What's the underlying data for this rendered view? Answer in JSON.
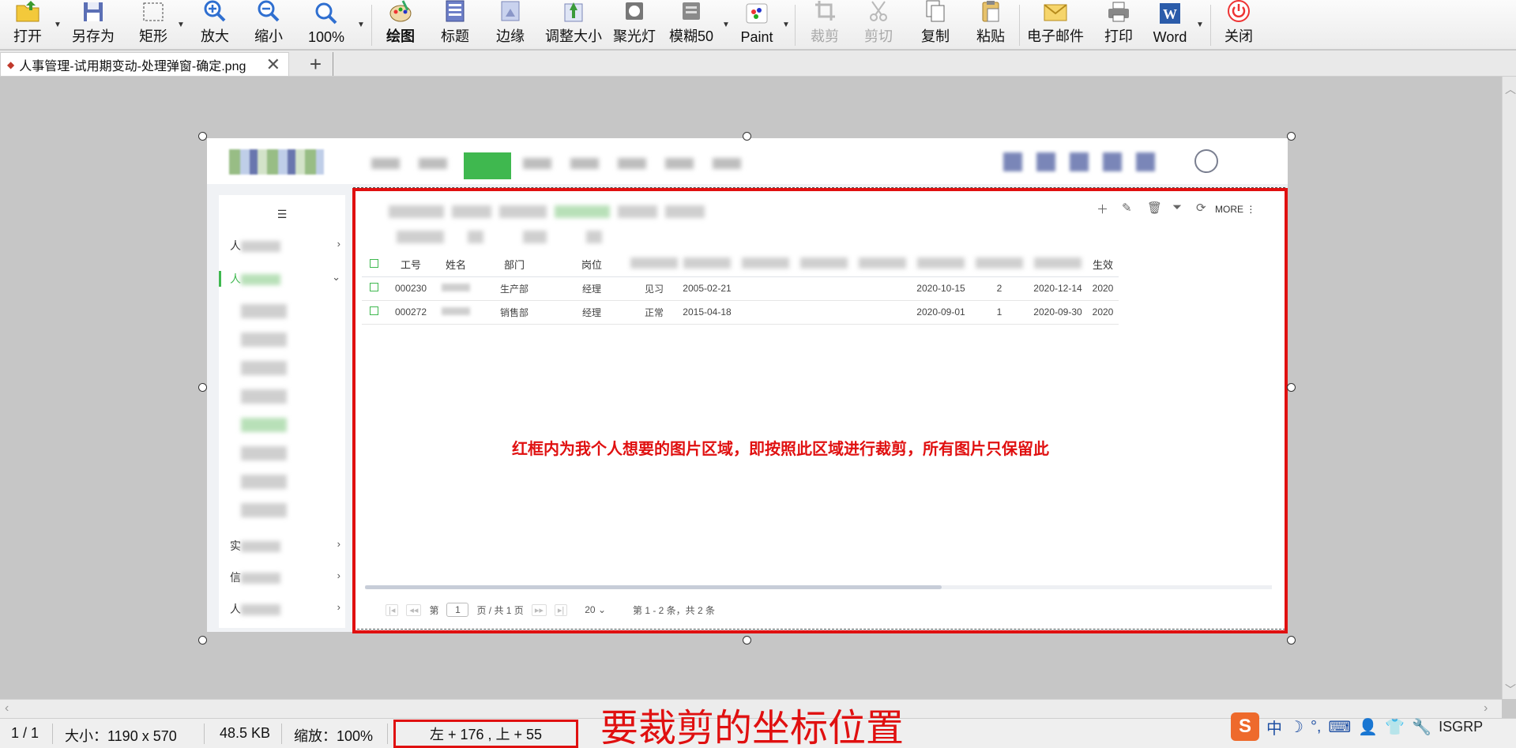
{
  "toolbar": {
    "open": "打开",
    "save_as": "另存为",
    "rectangle": "矩形",
    "zoom_in": "放大",
    "zoom_out": "缩小",
    "zoom_100": "100%",
    "draw": "绘图",
    "caption": "标题",
    "border": "边缘",
    "resize": "调整大小",
    "spotlight": "聚光灯",
    "blur": "模糊50",
    "paint": "Paint",
    "crop": "裁剪",
    "cut": "剪切",
    "copy": "复制",
    "paste": "粘贴",
    "email": "电子邮件",
    "print": "打印",
    "word": "Word",
    "close": "关闭"
  },
  "tab": {
    "title": "人事管理-试用期变动-处理弹窗-确定.png",
    "close_glyph": "✕",
    "add_glyph": "+"
  },
  "image": {
    "sidebar": {
      "collapse_glyph": "☰",
      "item1": "人",
      "item2": "人",
      "item3": "实",
      "item4": "信",
      "item5": "人"
    },
    "grid_toolbar": {
      "more": "MORE"
    },
    "table": {
      "headers": [
        "工号",
        "姓名",
        "部门",
        "岗位"
      ],
      "rows": [
        {
          "id": "000230",
          "dept": "生产部",
          "post": "经理",
          "status": "见习",
          "date1": "2005-02-21",
          "date2": "2020-10-15",
          "count": "2",
          "date3": "2020-12-14",
          "date4": "2020"
        },
        {
          "id": "000272",
          "dept": "销售部",
          "post": "经理",
          "status": "正常",
          "date1": "2015-04-18",
          "date2": "2020-09-01",
          "count": "1",
          "date3": "2020-09-30",
          "date4": "2020"
        }
      ],
      "last_header": "生效"
    },
    "annotation": "红框内为我个人想要的图片区域，即按照此区域进行裁剪，所有图片只保留此",
    "pager": {
      "page_prefix": "第",
      "page_value": "1",
      "page_suffix": "页 / 共 1 页",
      "page_size": "20",
      "summary": "第 1 - 2 条，共 2 条"
    }
  },
  "status": {
    "page": "1 / 1",
    "size": "大小：1190 x 570",
    "file_size": "48.5 KB",
    "zoom": "缩放：100%",
    "coords": "左 + 176 , 上 + 55"
  },
  "overlay_note": "要裁剪的坐标位置",
  "ime": {
    "mode": "中",
    "label": "ISGRP"
  },
  "colors": {
    "accent_green": "#3fb84f",
    "annotation_red": "#e01010"
  }
}
